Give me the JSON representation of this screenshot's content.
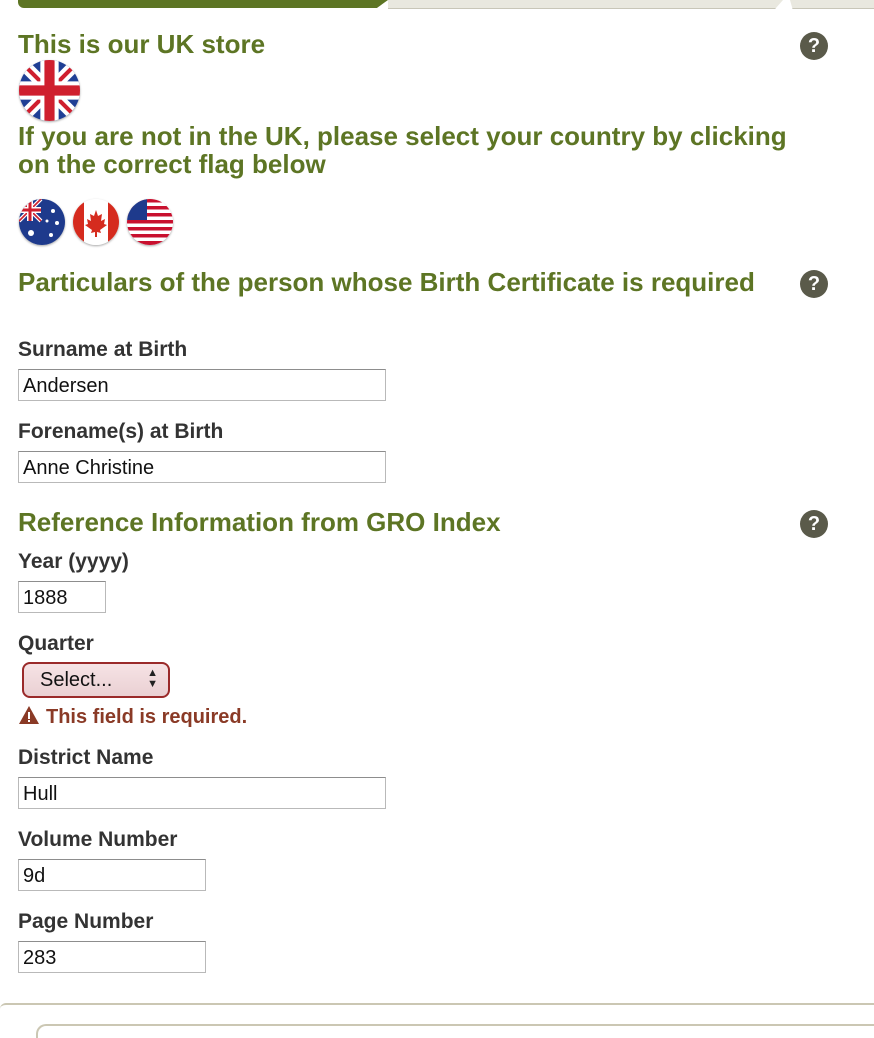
{
  "store": {
    "heading": "This is our UK store",
    "current_flag": "uk-flag",
    "select_country_text": "If you are not in the UK, please select your country by clicking on the correct flag below",
    "country_flags": [
      "australia-flag",
      "canada-flag",
      "usa-flag"
    ]
  },
  "particulars": {
    "heading": "Particulars of the person whose Birth Certificate is required",
    "surname_label": "Surname at Birth",
    "surname_value": "Andersen",
    "forename_label": "Forename(s) at Birth",
    "forename_value": "Anne Christine"
  },
  "reference": {
    "heading": "Reference Information from GRO Index",
    "year_label": "Year (yyyy)",
    "year_value": "1888",
    "quarter_label": "Quarter",
    "quarter_selected": "Select...",
    "quarter_error": "This field is required.",
    "district_label": "District Name",
    "district_value": "Hull",
    "volume_label": "Volume Number",
    "volume_value": "9d",
    "page_label": "Page Number",
    "page_value": "283"
  },
  "help_icon_glyph": "?",
  "colors": {
    "heading_green": "#5d7524",
    "error_red": "#8a3a26",
    "select_border": "#9a2a2a",
    "help_icon_bg": "#5a5a4a"
  }
}
